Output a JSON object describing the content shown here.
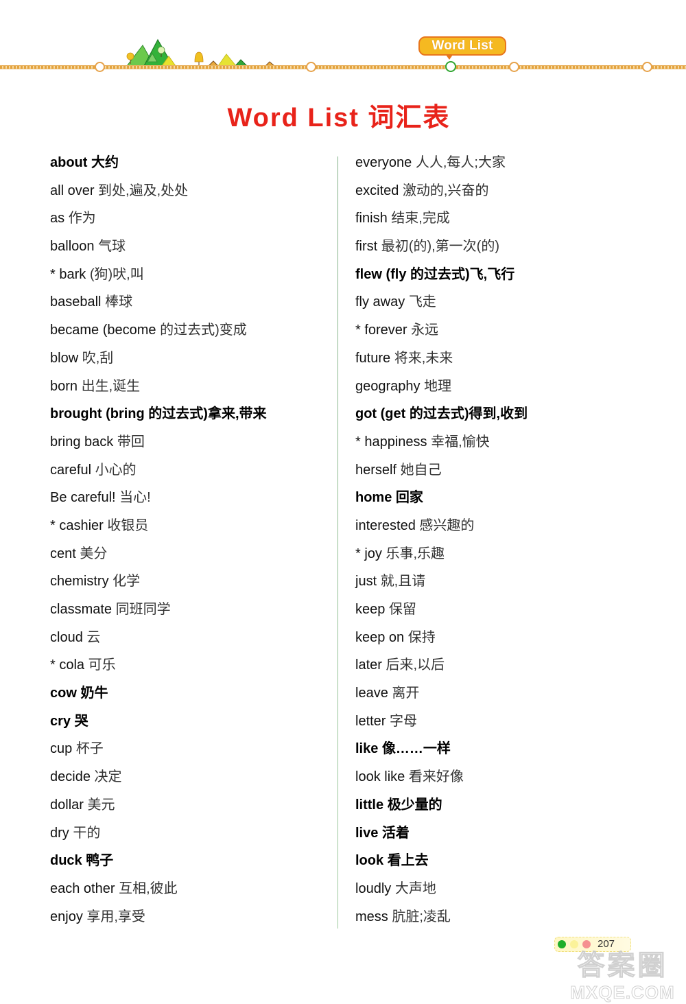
{
  "header": {
    "badge_label": "Word List"
  },
  "title": "Word List 词汇表",
  "left_column": [
    {
      "en": "about",
      "zh": "大约",
      "bold": true
    },
    {
      "en": "all over",
      "zh": "到处,遍及,处处",
      "bold": false
    },
    {
      "en": "as",
      "zh": "作为",
      "bold": false
    },
    {
      "en": "balloon",
      "zh": "气球",
      "bold": false
    },
    {
      "en": "* bark",
      "zh": "(狗)吠,叫",
      "bold": false
    },
    {
      "en": "baseball",
      "zh": "棒球",
      "bold": false
    },
    {
      "en": "became (become",
      "zh": "的过去式)变成",
      "bold": false
    },
    {
      "en": "blow",
      "zh": "吹,刮",
      "bold": false
    },
    {
      "en": "born",
      "zh": "出生,诞生",
      "bold": false
    },
    {
      "en": "brought (bring",
      "zh": "的过去式)拿来,带来",
      "bold": true
    },
    {
      "en": "bring back",
      "zh": "带回",
      "bold": false
    },
    {
      "en": "careful",
      "zh": "小心的",
      "bold": false
    },
    {
      "en": "Be careful!",
      "zh": "当心!",
      "bold": false
    },
    {
      "en": "* cashier",
      "zh": "收银员",
      "bold": false
    },
    {
      "en": "cent",
      "zh": "美分",
      "bold": false
    },
    {
      "en": "chemistry",
      "zh": "化学",
      "bold": false
    },
    {
      "en": "classmate",
      "zh": "同班同学",
      "bold": false
    },
    {
      "en": "cloud",
      "zh": "云",
      "bold": false
    },
    {
      "en": "* cola",
      "zh": "可乐",
      "bold": false
    },
    {
      "en": "cow",
      "zh": "奶牛",
      "bold": true
    },
    {
      "en": "cry",
      "zh": "哭",
      "bold": true
    },
    {
      "en": "cup",
      "zh": "杯子",
      "bold": false
    },
    {
      "en": "decide",
      "zh": "决定",
      "bold": false
    },
    {
      "en": "dollar",
      "zh": "美元",
      "bold": false
    },
    {
      "en": "dry",
      "zh": "干的",
      "bold": false
    },
    {
      "en": "duck",
      "zh": "鸭子",
      "bold": true
    },
    {
      "en": "each other",
      "zh": "互相,彼此",
      "bold": false
    },
    {
      "en": "enjoy",
      "zh": "享用,享受",
      "bold": false
    }
  ],
  "right_column": [
    {
      "en": "everyone",
      "zh": "人人,每人;大家",
      "bold": false
    },
    {
      "en": "excited",
      "zh": "激动的,兴奋的",
      "bold": false
    },
    {
      "en": "finish",
      "zh": "结束,完成",
      "bold": false
    },
    {
      "en": "first",
      "zh": "最初(的),第一次(的)",
      "bold": false
    },
    {
      "en": "flew (fly",
      "zh": "的过去式)飞,飞行",
      "bold": true
    },
    {
      "en": "fly away",
      "zh": "飞走",
      "bold": false
    },
    {
      "en": "* forever",
      "zh": "永远",
      "bold": false
    },
    {
      "en": "future",
      "zh": "将来,未来",
      "bold": false
    },
    {
      "en": "geography",
      "zh": "地理",
      "bold": false
    },
    {
      "en": "got (get",
      "zh": "的过去式)得到,收到",
      "bold": true
    },
    {
      "en": "* happiness",
      "zh": "幸福,愉快",
      "bold": false
    },
    {
      "en": "herself",
      "zh": "她自己",
      "bold": false
    },
    {
      "en": "home",
      "zh": "回家",
      "bold": true
    },
    {
      "en": "interested",
      "zh": "感兴趣的",
      "bold": false
    },
    {
      "en": "* joy",
      "zh": "乐事,乐趣",
      "bold": false
    },
    {
      "en": "just",
      "zh": "就,且请",
      "bold": false
    },
    {
      "en": "keep",
      "zh": "保留",
      "bold": false
    },
    {
      "en": "keep on",
      "zh": "保持",
      "bold": false
    },
    {
      "en": "later",
      "zh": "后来,以后",
      "bold": false
    },
    {
      "en": "leave",
      "zh": "离开",
      "bold": false
    },
    {
      "en": "letter",
      "zh": "字母",
      "bold": false
    },
    {
      "en": "like",
      "zh": "像……一样",
      "bold": true
    },
    {
      "en": "look like",
      "zh": "看来好像",
      "bold": false
    },
    {
      "en": "little",
      "zh": "极少量的",
      "bold": true
    },
    {
      "en": "live",
      "zh": "活着",
      "bold": true
    },
    {
      "en": "look",
      "zh": "看上去",
      "bold": true
    },
    {
      "en": "loudly",
      "zh": "大声地",
      "bold": false
    },
    {
      "en": "mess",
      "zh": "肮脏;凌乱",
      "bold": false
    }
  ],
  "footer": {
    "page_number": "207",
    "watermark_top": "答案圈",
    "watermark_bottom": "MXQE.COM"
  }
}
